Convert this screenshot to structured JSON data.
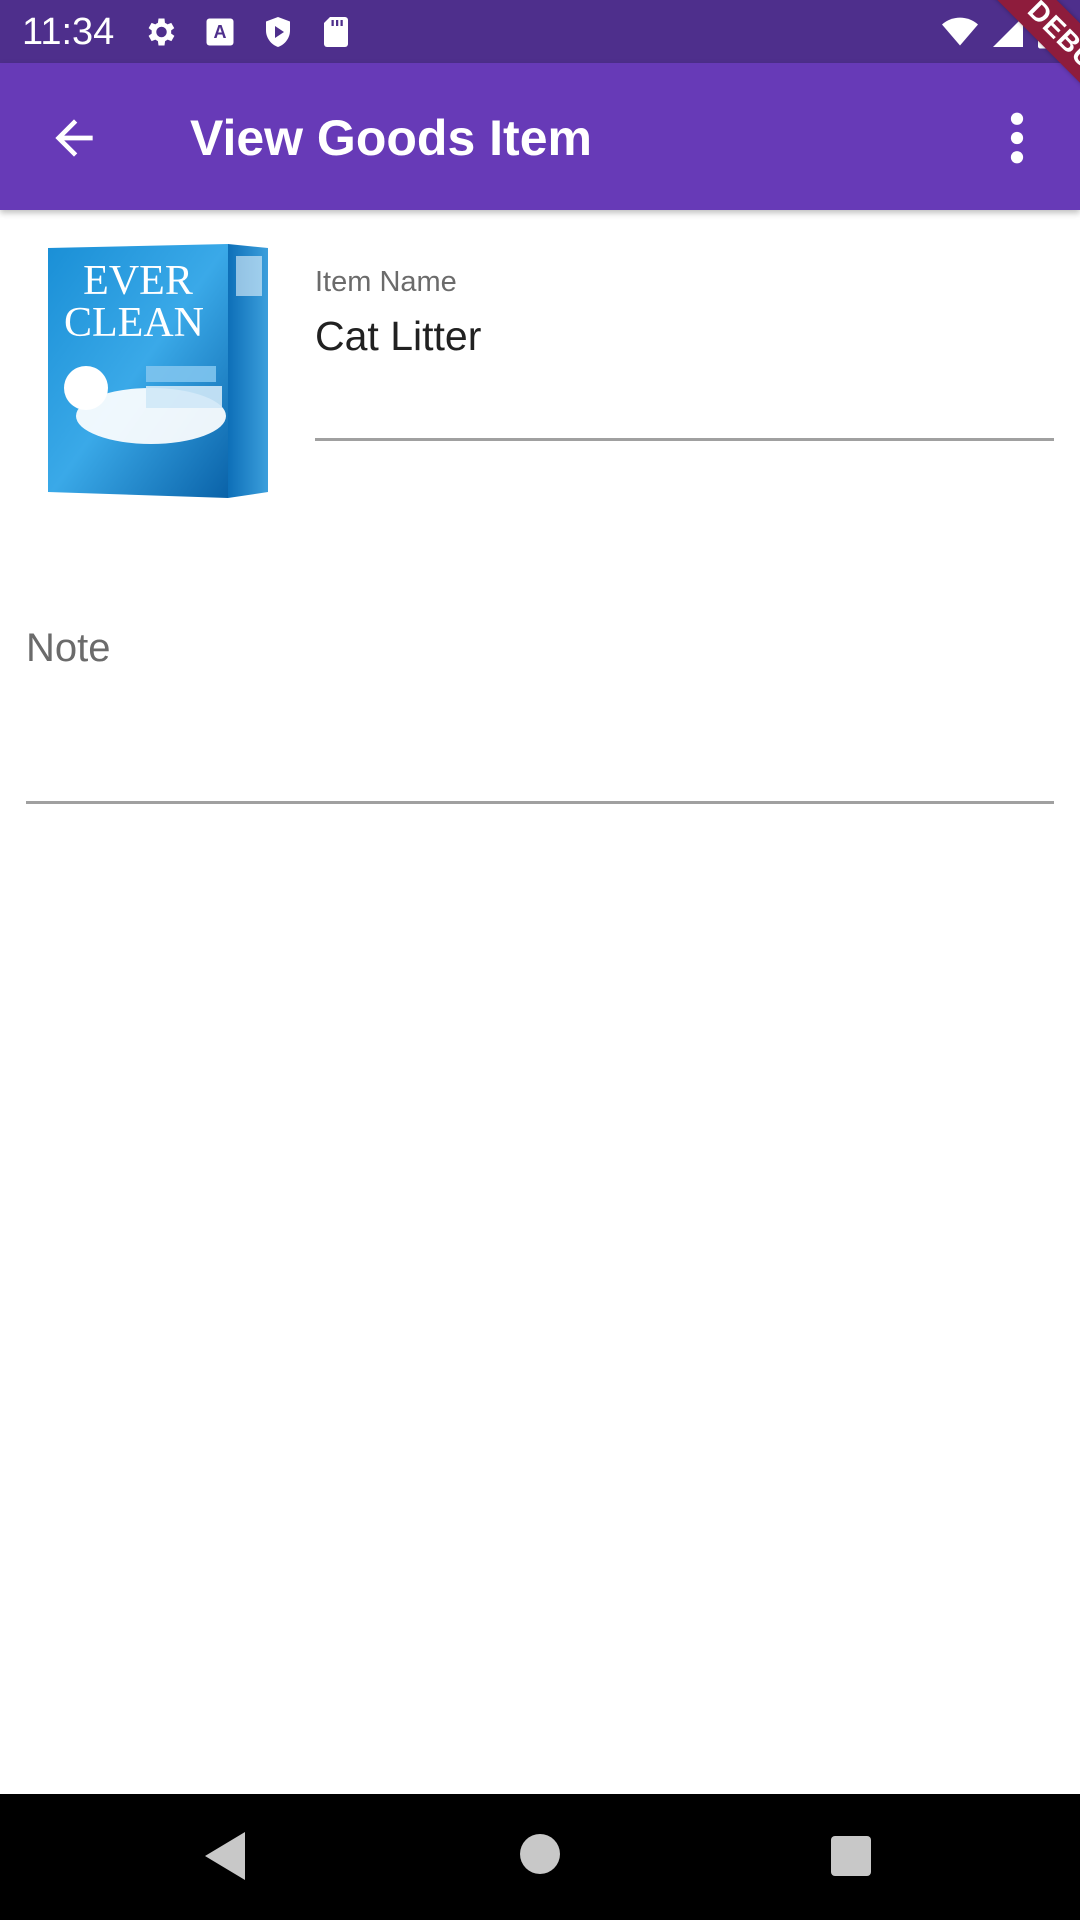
{
  "status_bar": {
    "time": "11:34",
    "left_icons": [
      "gear-icon",
      "a-badge-icon",
      "shield-play-icon",
      "sd-card-icon"
    ],
    "right_icons": [
      "wifi-icon",
      "signal-icon",
      "battery-icon"
    ]
  },
  "app_bar": {
    "title": "View Goods Item",
    "back_icon": "arrow-back-icon",
    "menu_icon": "more-vert-icon",
    "color": "#673ab7"
  },
  "debug_banner": "DEBUG",
  "item": {
    "image": "product-image",
    "name_label": "Item Name",
    "name_value": "Cat Litter",
    "note_label": "Note",
    "note_value": ""
  },
  "nav_bar": {
    "buttons": [
      "nav-back-icon",
      "nav-home-icon",
      "nav-recents-icon"
    ]
  }
}
